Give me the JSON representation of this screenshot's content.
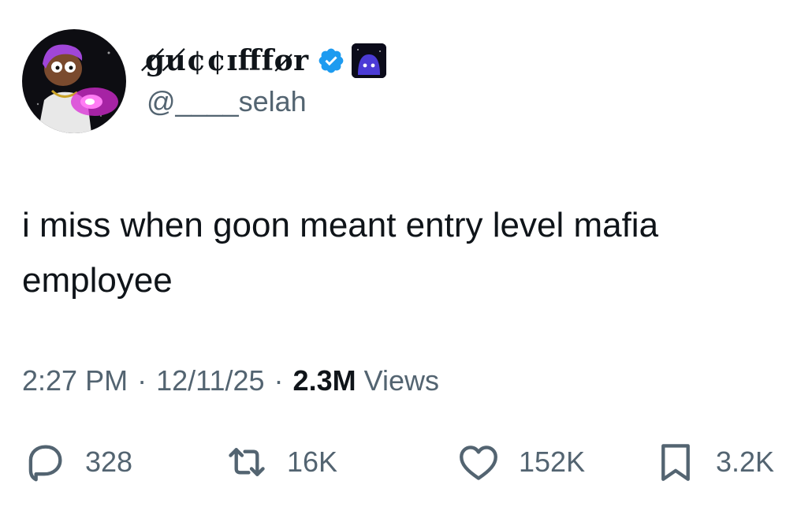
{
  "author": {
    "display_name": "g̸u̸¢¢ɪﬀfør",
    "display_name_text": "gu̸¢¢ɪfør",
    "handle": "@____selah",
    "verified": true,
    "badge_color": "#1d9bf0"
  },
  "tweet": {
    "text": "i miss when goon meant entry level mafia employee",
    "time": "2:27 PM",
    "date": "12/11/25",
    "views_count": "2.3M",
    "views_label": "Views",
    "separator": "·"
  },
  "actions": {
    "replies": "328",
    "retweets": "16K",
    "likes": "152K",
    "bookmarks": "3.2K"
  },
  "icons": {
    "reply": "reply-icon",
    "retweet": "retweet-icon",
    "like": "heart-icon",
    "bookmark": "bookmark-icon",
    "verified": "verified-badge-icon"
  },
  "colors": {
    "text_primary": "#0f1419",
    "text_secondary": "#536471",
    "verified_blue": "#1d9bf0"
  }
}
